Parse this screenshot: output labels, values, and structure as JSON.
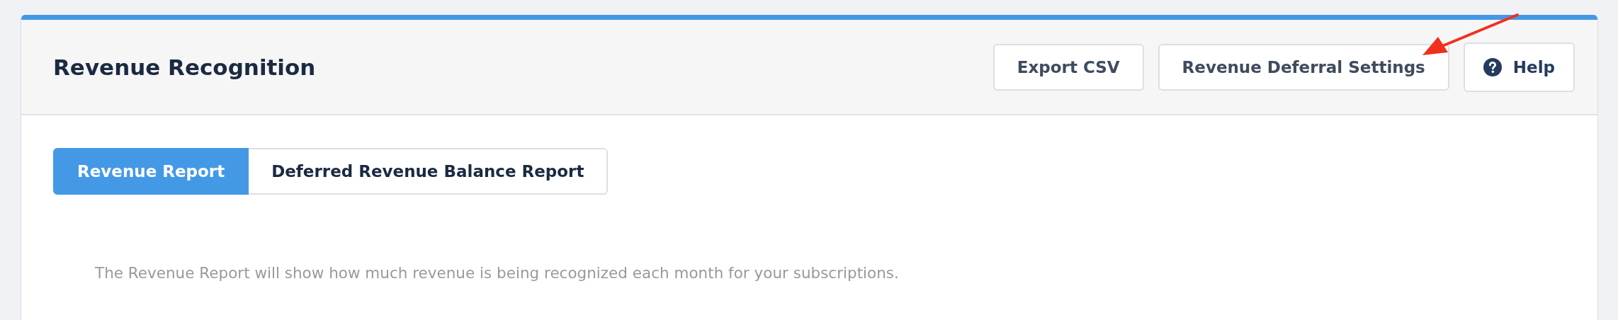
{
  "header": {
    "title": "Revenue Recognition",
    "buttons": [
      {
        "label": "Export CSV",
        "kind": "plain"
      },
      {
        "label": "Revenue Deferral Settings",
        "kind": "plain"
      },
      {
        "label": "Help",
        "kind": "help"
      }
    ]
  },
  "tabs": [
    {
      "label": "Revenue Report",
      "selected": true
    },
    {
      "label": "Deferred Revenue Balance Report",
      "selected": false
    }
  ],
  "description": "The Revenue Report will show how much revenue is being recognized each month for your subscriptions."
}
